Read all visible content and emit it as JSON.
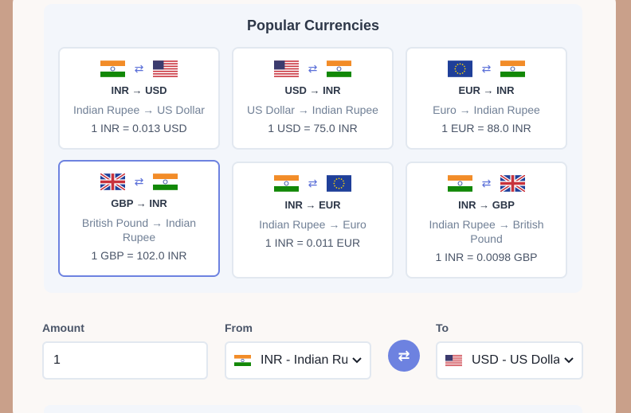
{
  "popular": {
    "title": "Popular Currencies",
    "tiles": [
      {
        "from_flag": "india-flag",
        "to_flag": "us-flag",
        "pair": "INR → USD",
        "names": "Indian Rupee → US Dollar",
        "rate": "1 INR = 0.013 USD",
        "active": false
      },
      {
        "from_flag": "us-flag",
        "to_flag": "india-flag",
        "pair": "USD → INR",
        "names": "US Dollar → Indian Rupee",
        "rate": "1 USD = 75.0 INR",
        "active": false
      },
      {
        "from_flag": "eu-flag",
        "to_flag": "india-flag",
        "pair": "EUR → INR",
        "names": "Euro → Indian Rupee",
        "rate": "1 EUR = 88.0 INR",
        "active": false
      },
      {
        "from_flag": "uk-flag",
        "to_flag": "india-flag",
        "pair": "GBP → INR",
        "names": "British Pound → Indian Rupee",
        "rate": "1 GBP = 102.0 INR",
        "active": true
      },
      {
        "from_flag": "india-flag",
        "to_flag": "eu-flag",
        "pair": "INR → EUR",
        "names": "Indian Rupee → Euro",
        "rate": "1 INR = 0.011 EUR",
        "active": false
      },
      {
        "from_flag": "india-flag",
        "to_flag": "uk-flag",
        "pair": "INR → GBP",
        "names": "Indian Rupee → British Pound",
        "rate": "1 INR = 0.0098 GBP",
        "active": false
      }
    ]
  },
  "converter": {
    "amount_label": "Amount",
    "amount_value": "1",
    "from_label": "From",
    "from_selected": "INR - Indian Rupee",
    "from_flag": "india-flag",
    "to_label": "To",
    "to_selected": "USD - US Dollar",
    "to_flag": "us-flag",
    "swap_icon": "swap-arrows-icon"
  },
  "colors": {
    "accent": "#6d82e0",
    "page_bg": "#c9a08a",
    "card_bg": "#fbf8f6",
    "panel_bg": "#f3f6fb"
  }
}
